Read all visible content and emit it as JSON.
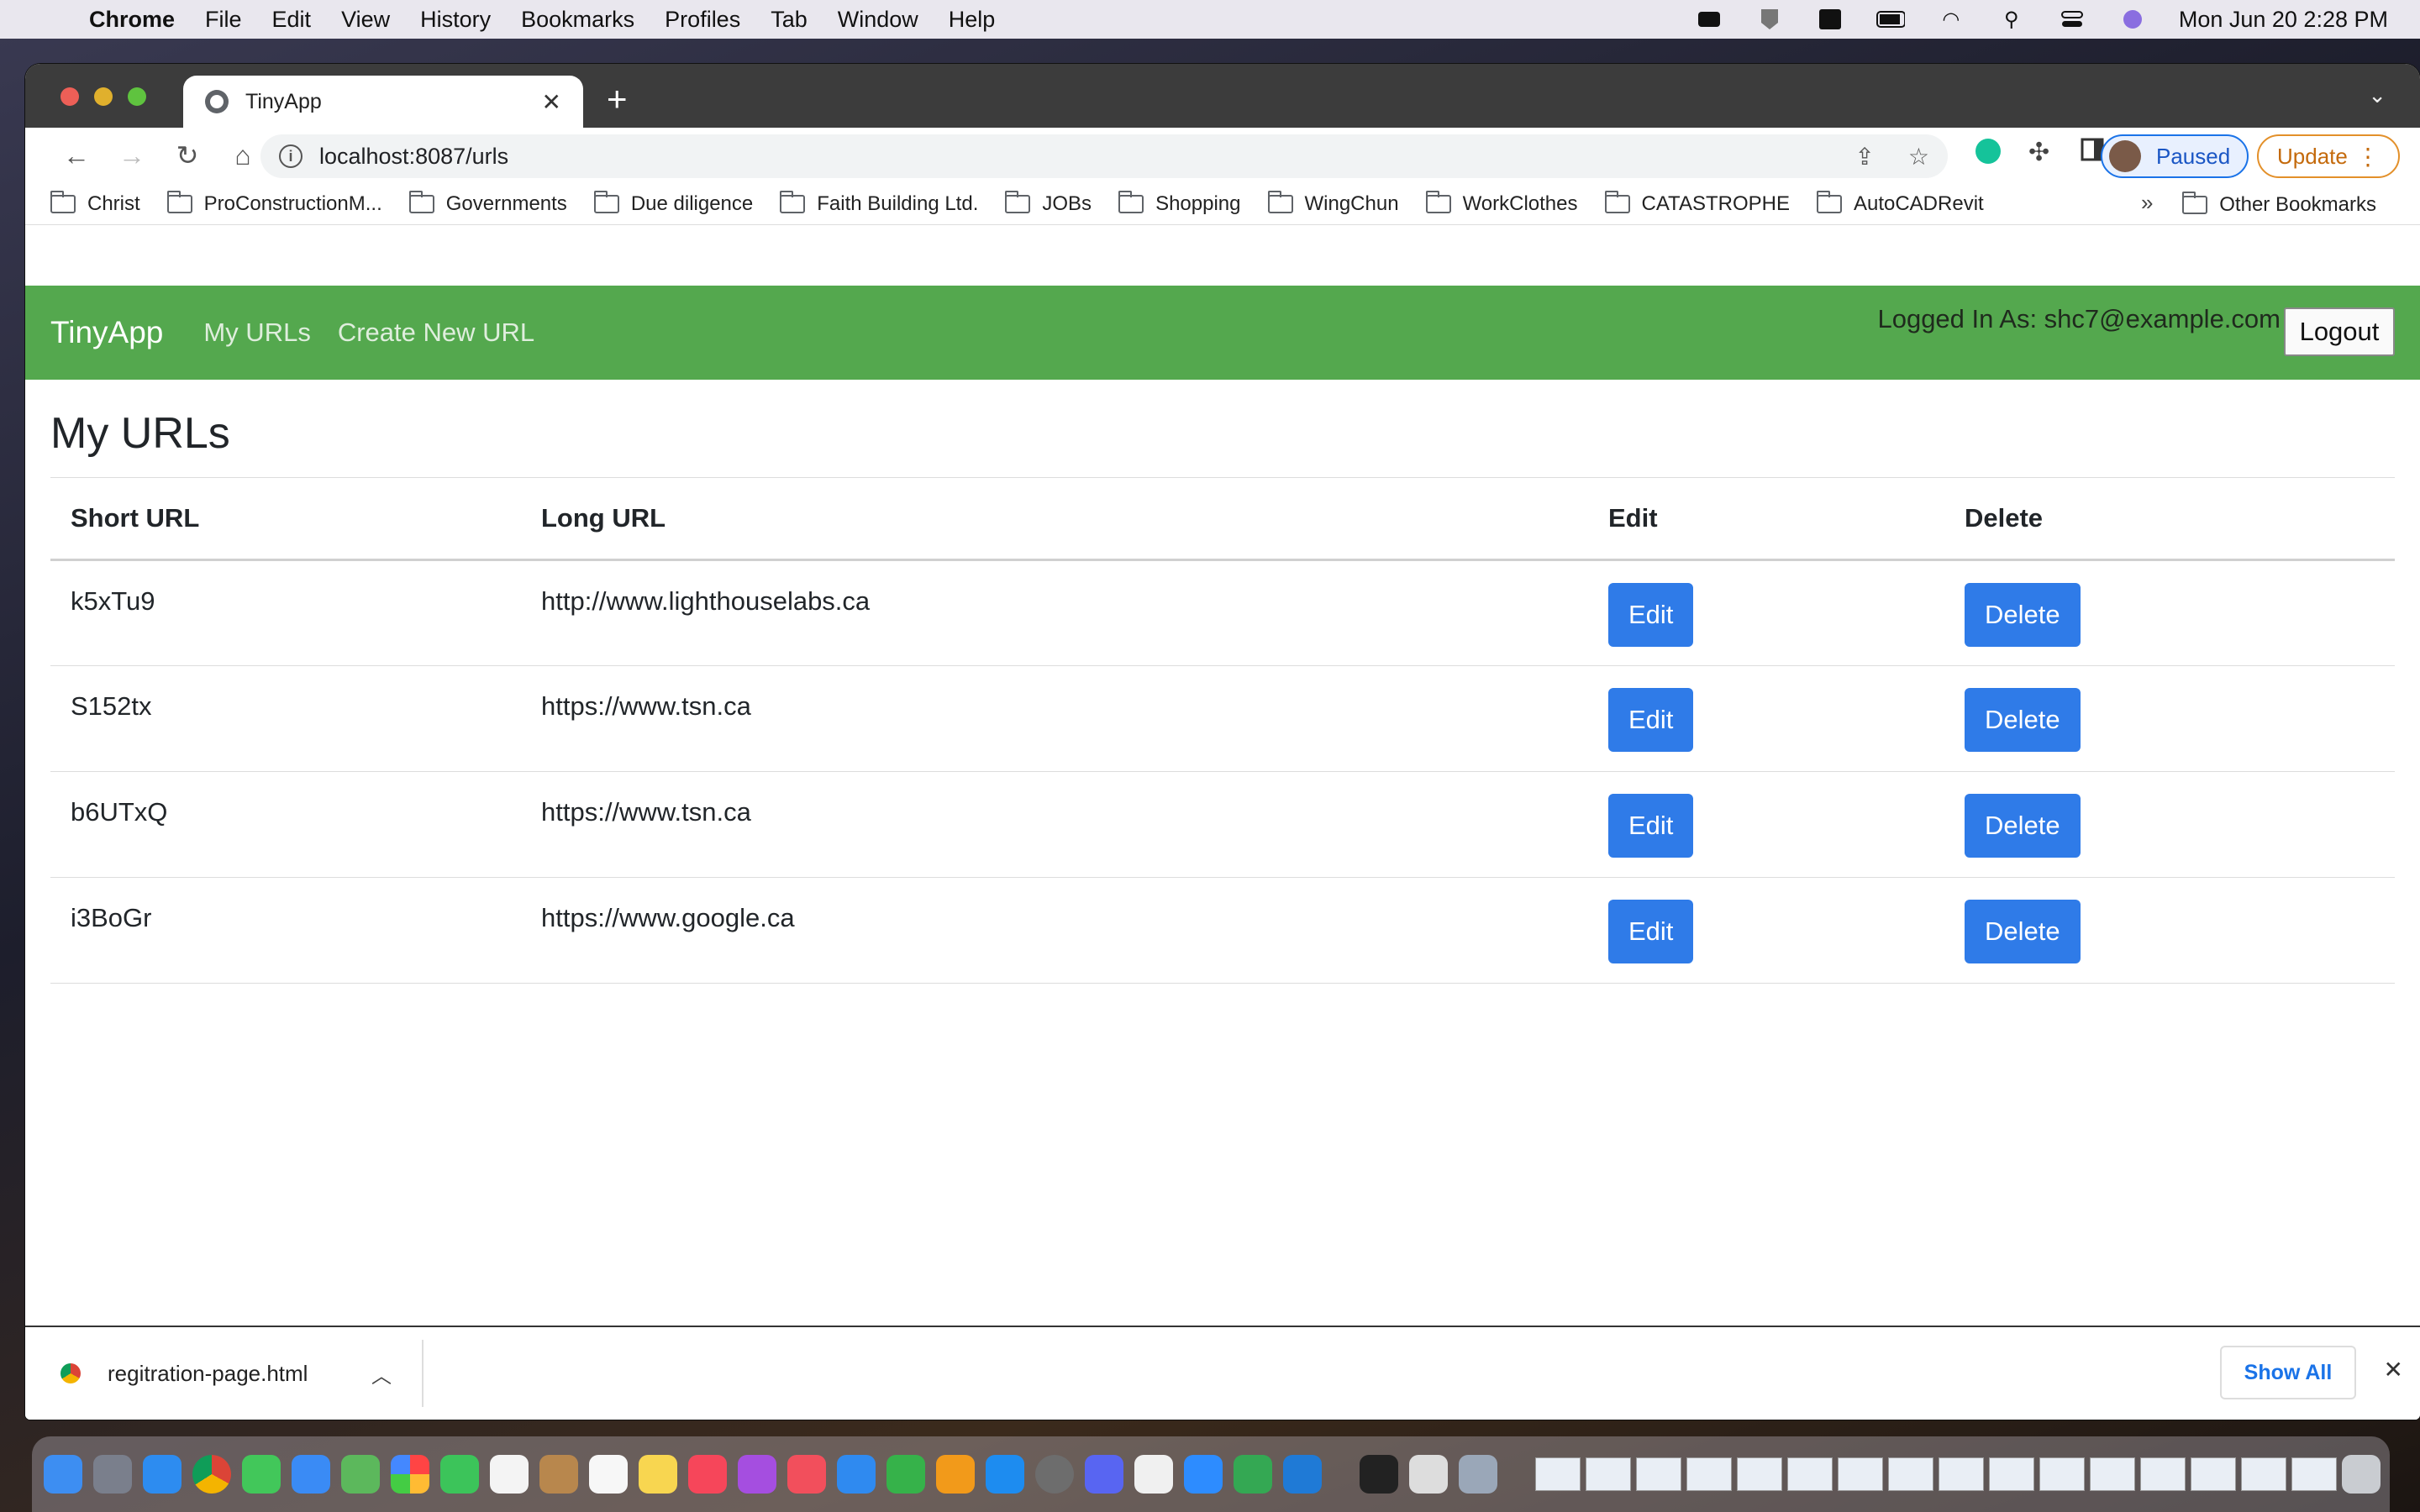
{
  "menubar": {
    "app_name": "Chrome",
    "items": [
      "File",
      "Edit",
      "View",
      "History",
      "Bookmarks",
      "Profiles",
      "Tab",
      "Window",
      "Help"
    ],
    "clock": "Mon Jun 20  2:28 PM"
  },
  "browser": {
    "tab_title": "TinyApp",
    "url": "localhost:8087/urls",
    "profile_label": "Paused",
    "update_label": "Update",
    "bookmarks": [
      "Christ",
      "ProConstructionM...",
      "Governments",
      "Due diligence",
      "Faith Building Ltd.",
      "JOBs",
      "Shopping",
      "WingChun",
      "WorkClothes",
      "CATASTROPHE",
      "AutoCADRevit"
    ],
    "bookmarks_overflow": "»",
    "other_bookmarks": "Other Bookmarks"
  },
  "app": {
    "brand": "TinyApp",
    "nav_my_urls": "My URLs",
    "nav_create": "Create New URL",
    "logged_in": "Logged In As: shc7@example.com",
    "logout_label": "Logout",
    "page_title": "My URLs",
    "table": {
      "headers": [
        "Short URL",
        "Long URL",
        "Edit",
        "Delete"
      ],
      "rows": [
        {
          "short": "k5xTu9",
          "long": "http://www.lighthouselabs.ca",
          "edit": "Edit",
          "delete": "Delete"
        },
        {
          "short": "S152tx",
          "long": "https://www.tsn.ca",
          "edit": "Edit",
          "delete": "Delete"
        },
        {
          "short": "b6UTxQ",
          "long": "https://www.tsn.ca",
          "edit": "Edit",
          "delete": "Delete"
        },
        {
          "short": "i3BoGr",
          "long": "https://www.google.ca",
          "edit": "Edit",
          "delete": "Delete"
        }
      ]
    }
  },
  "downloads": {
    "file_name": "regitration-page.html",
    "show_all": "Show All"
  },
  "colors": {
    "navbar": "#54a84e",
    "primary_button": "#2f7be8"
  }
}
